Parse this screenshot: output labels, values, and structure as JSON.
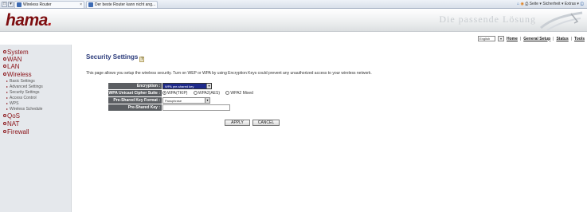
{
  "browser": {
    "tabs": [
      {
        "label": "Wireless Router"
      },
      {
        "label": "Der beste Router kann nicht ang..."
      }
    ],
    "command_bar": "Seite ▾  Sicherheit ▾  Extras ▾"
  },
  "header": {
    "logo": "hama",
    "logo_dot": ".",
    "slogan": "Die passende Lösung"
  },
  "toolbar": {
    "language": "English",
    "go_label": "",
    "links": [
      "Home",
      "General Setup",
      "Status",
      "Tools"
    ]
  },
  "sidebar": {
    "items": [
      {
        "label": "System"
      },
      {
        "label": "WAN"
      },
      {
        "label": "LAN"
      },
      {
        "label": "Wireless"
      },
      {
        "label": "QoS"
      },
      {
        "label": "NAT"
      },
      {
        "label": "Firewall"
      }
    ],
    "wireless_sub": [
      {
        "label": "Basic Settings"
      },
      {
        "label": "Advanced Settings"
      },
      {
        "label": "Security Settings"
      },
      {
        "label": "Access Control"
      },
      {
        "label": "WPS"
      },
      {
        "label": "Wireless Schedule"
      }
    ]
  },
  "main": {
    "title": "Security Settings",
    "description": "This page allows you setup the wireless security. Turn on WEP or WPA by using Encryption Keys could prevent any unauthorized access to your wireless network.",
    "form": {
      "encryption_label": "Encryption :",
      "encryption_value": "WPA pre-shared key",
      "cipher_label": "WPA Unicast Cipher Suite :",
      "cipher_options": [
        "WPA(TKIP)",
        "WPA2(AES)",
        "WPA2 Mixed"
      ],
      "cipher_selected": 0,
      "psk_format_label": "Pre-Shared Key Format :",
      "psk_format_value": "Passphrase",
      "psk_label": "Pre-Shared Key :",
      "psk_value": ""
    },
    "buttons": {
      "apply": "APPLY",
      "cancel": "CANCEL"
    }
  },
  "colors": {
    "brand": "#7d0d0f",
    "nav_text": "#8a1116",
    "label_bg": "#5b5e62",
    "title": "#2a3a7a",
    "select_highlight": "#1e2a8a"
  }
}
